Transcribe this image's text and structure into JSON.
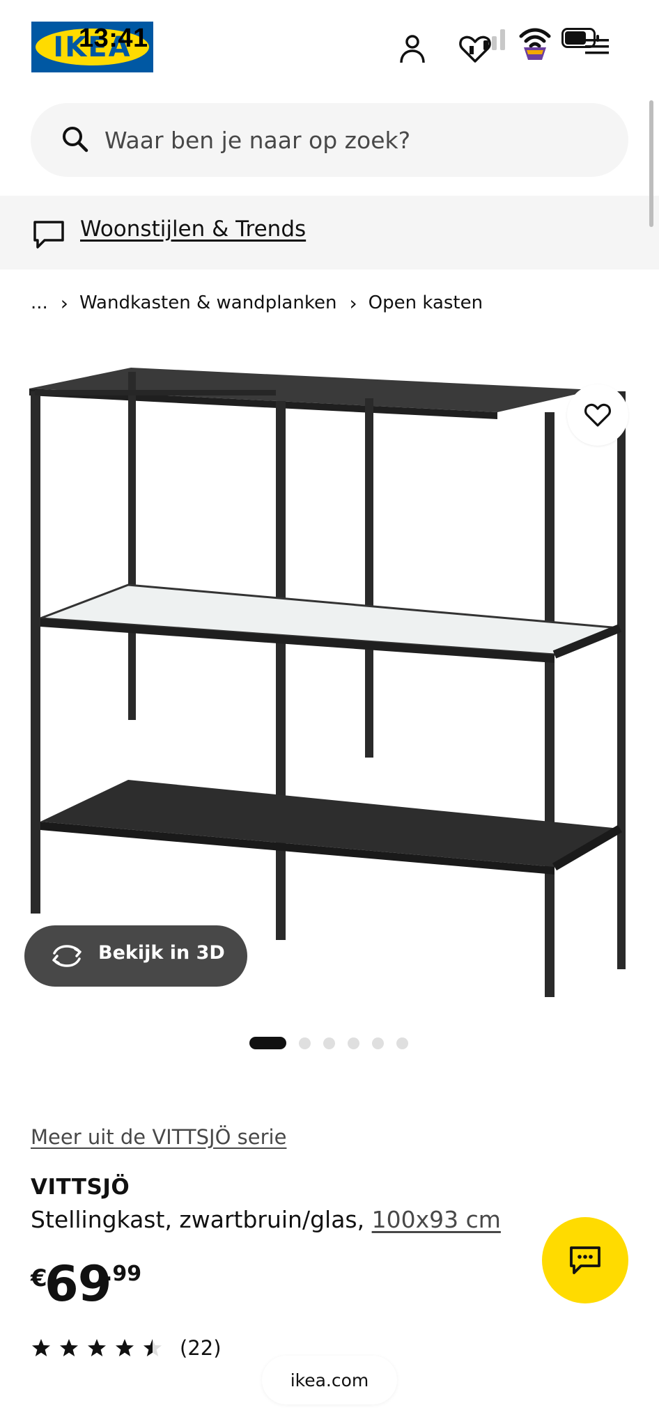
{
  "status_bar": {
    "time": "13:41"
  },
  "brand": {
    "logo_text": "IKEA",
    "blue": "#0058a3",
    "yellow": "#ffdb00"
  },
  "header": {
    "icons": [
      "profile-icon",
      "heart-icon",
      "signal-icon",
      "wifi-icon",
      "battery-icon",
      "menu-icon"
    ]
  },
  "search": {
    "placeholder": "Waar ben je naar op zoek?"
  },
  "banner": {
    "link": "Woonstijlen & Trends"
  },
  "breadcrumb": {
    "items": [
      "...",
      "Wandkasten & wandplanken",
      "Open kasten"
    ]
  },
  "gallery": {
    "view_3d_label": "Bekijk in 3D",
    "image_count": 6,
    "active_index": 0
  },
  "product": {
    "series_link": "Meer uit de VITTSJÖ serie",
    "name": "VITTSJÖ",
    "description": "Stellingkast, zwartbruin/glas, ",
    "size_link": "100x93 cm",
    "price": {
      "currency": "€",
      "integer": "69",
      "decimal": ".99"
    },
    "rating": {
      "value": 4.5,
      "max": 5,
      "count_label": "(22)"
    }
  },
  "browser": {
    "url": "ikea.com"
  }
}
